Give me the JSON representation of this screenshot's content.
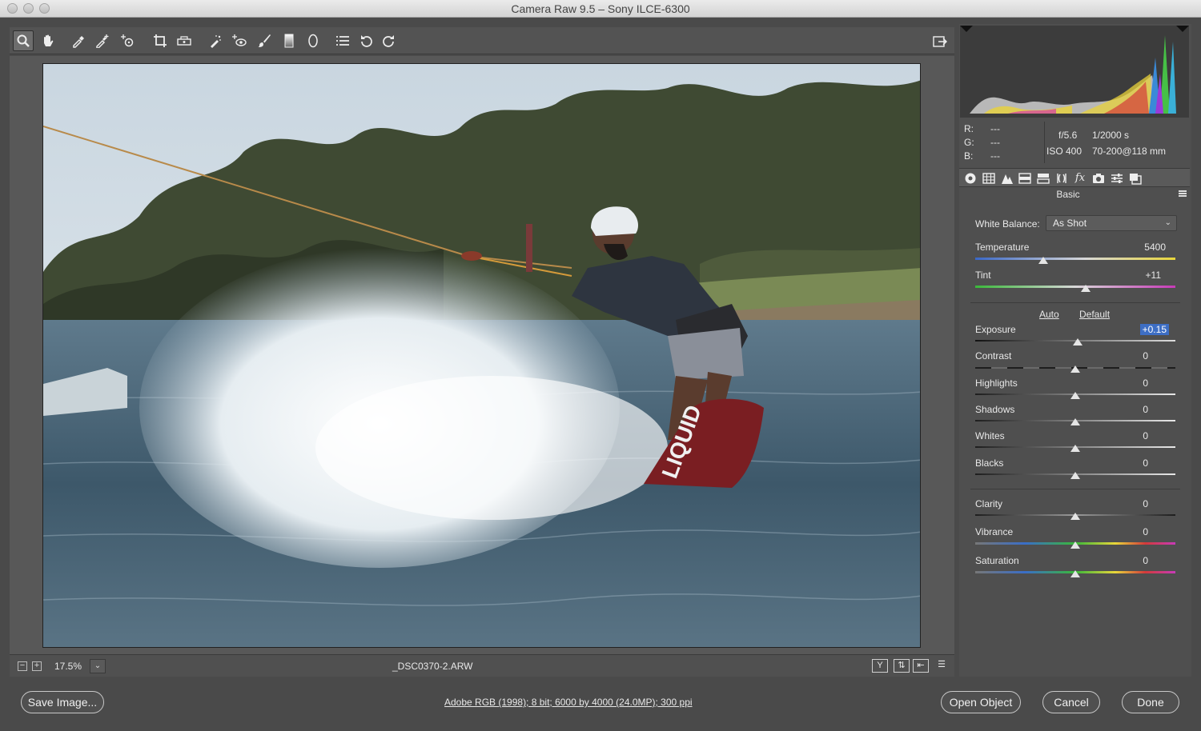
{
  "window": {
    "title": "Camera Raw 9.5  –  Sony ILCE-6300"
  },
  "toolbar": {
    "tools": [
      {
        "name": "zoom-tool",
        "icon": "magnifier-icon",
        "active": true
      },
      {
        "name": "hand-tool",
        "icon": "hand-icon"
      },
      {
        "name": "white-balance-tool",
        "icon": "eyedropper-icon"
      },
      {
        "name": "color-sampler-tool",
        "icon": "eyedropper-plus-icon"
      },
      {
        "name": "targeted-adjustment-tool",
        "icon": "target-adjust-icon"
      },
      {
        "name": "crop-tool",
        "icon": "crop-icon"
      },
      {
        "name": "straighten-tool",
        "icon": "level-icon"
      },
      {
        "name": "spot-removal-tool",
        "icon": "healing-brush-icon"
      },
      {
        "name": "red-eye-tool",
        "icon": "red-eye-icon"
      },
      {
        "name": "adjustment-brush-tool",
        "icon": "brush-icon"
      },
      {
        "name": "graduated-filter-tool",
        "icon": "graduated-filter-icon"
      },
      {
        "name": "radial-filter-tool",
        "icon": "ellipse-icon"
      },
      {
        "name": "preferences-tool",
        "icon": "list-icon"
      },
      {
        "name": "rotate-left-tool",
        "icon": "rotate-ccw-icon"
      },
      {
        "name": "rotate-right-tool",
        "icon": "rotate-cw-icon"
      }
    ],
    "fullscreen_icon": "export-icon"
  },
  "status": {
    "zoom": "17.5%",
    "filename": "_DSC0370-2.ARW",
    "view_buttons": [
      "Y",
      "⇅",
      "⇤",
      "☰"
    ]
  },
  "info": {
    "r_label": "R:",
    "g_label": "G:",
    "b_label": "B:",
    "r_value": "---",
    "g_value": "---",
    "b_value": "---",
    "aperture": "f/5.6",
    "shutter": "1/2000 s",
    "iso": "ISO 400",
    "lens": "70-200@118 mm"
  },
  "panel": {
    "title": "Basic",
    "white_balance_label": "White Balance:",
    "white_balance_value": "As Shot",
    "auto": "Auto",
    "default": "Default",
    "sliders": [
      {
        "id": "temperature",
        "label": "Temperature",
        "value": "5400",
        "pos": 0.34
      },
      {
        "id": "tint",
        "label": "Tint",
        "value": "+11",
        "pos": 0.55
      },
      {
        "id": "exposure",
        "label": "Exposure",
        "value": "+0.15",
        "pos": 0.51
      },
      {
        "id": "contrast",
        "label": "Contrast",
        "value": "0",
        "pos": 0.5
      },
      {
        "id": "highlights",
        "label": "Highlights",
        "value": "0",
        "pos": 0.5
      },
      {
        "id": "shadows",
        "label": "Shadows",
        "value": "0",
        "pos": 0.5
      },
      {
        "id": "whites",
        "label": "Whites",
        "value": "0",
        "pos": 0.5
      },
      {
        "id": "blacks",
        "label": "Blacks",
        "value": "0",
        "pos": 0.5
      },
      {
        "id": "clarity",
        "label": "Clarity",
        "value": "0",
        "pos": 0.5
      },
      {
        "id": "vibrance",
        "label": "Vibrance",
        "value": "0",
        "pos": 0.5
      },
      {
        "id": "saturation",
        "label": "Saturation",
        "value": "0",
        "pos": 0.5
      }
    ]
  },
  "footer": {
    "save_label": "Save Image...",
    "workflow_info": "Adobe RGB (1998); 8 bit; 6000 by 4000 (24.0MP); 300 ppi",
    "open_label": "Open Object",
    "cancel_label": "Cancel",
    "done_label": "Done"
  },
  "colors": {
    "accent": "#3d6ec4",
    "panel": "#4f4f4f",
    "background": "#4a4a4a"
  }
}
